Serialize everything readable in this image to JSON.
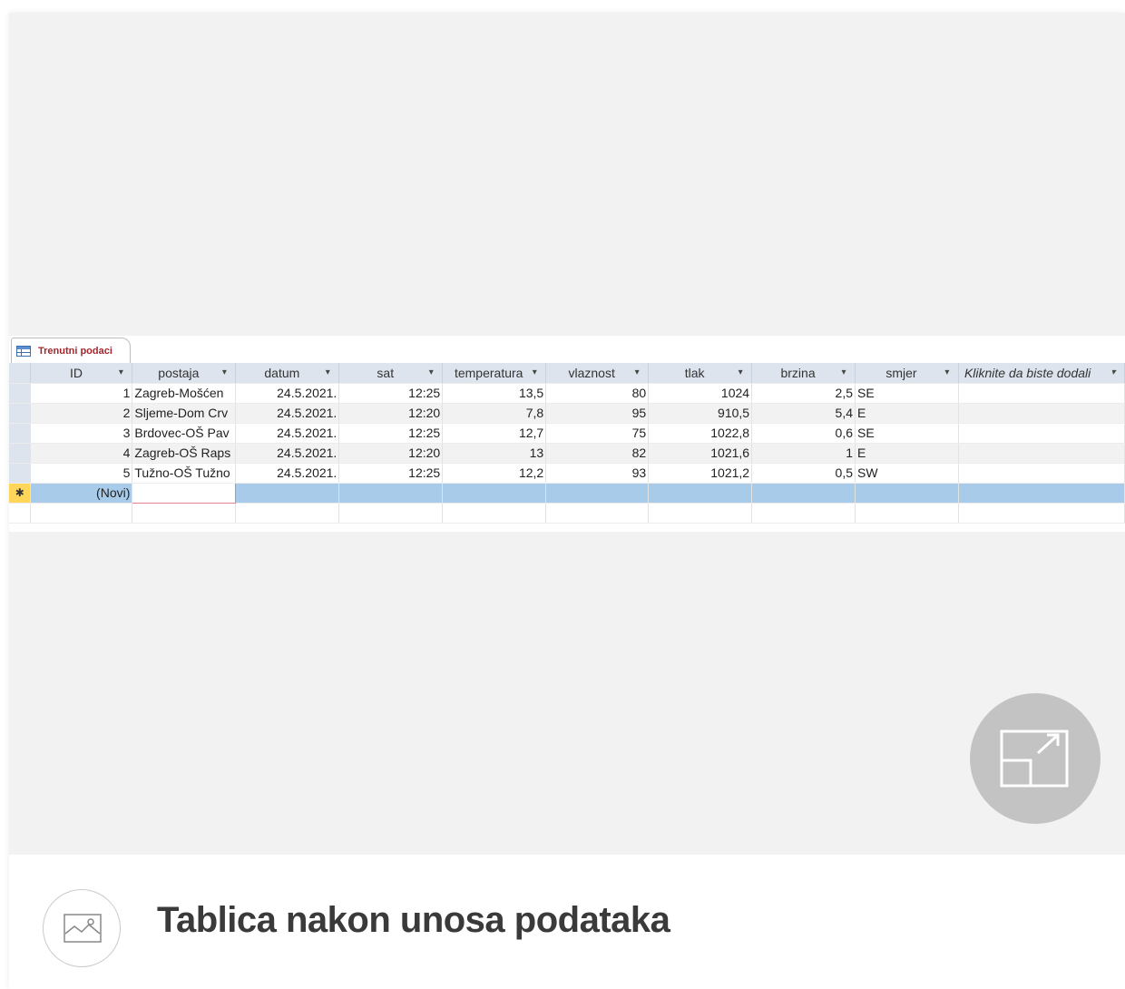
{
  "tab": {
    "label": "Trenutni podaci",
    "icon": "table-icon"
  },
  "columns": [
    {
      "label": "ID"
    },
    {
      "label": "postaja"
    },
    {
      "label": "datum"
    },
    {
      "label": "sat"
    },
    {
      "label": "temperatura"
    },
    {
      "label": "vlaznost"
    },
    {
      "label": "tlak"
    },
    {
      "label": "brzina"
    },
    {
      "label": "smjer"
    },
    {
      "label": "Kliknite da biste dodali"
    }
  ],
  "header_arrow": "▾",
  "rows": [
    {
      "id": "1",
      "postaja": "Zagreb-Mošćen",
      "datum": "24.5.2021.",
      "sat": "12:25",
      "temperatura": "13,5",
      "vlaznost": "80",
      "tlak": "1024",
      "brzina": "2,5",
      "smjer": "SE"
    },
    {
      "id": "2",
      "postaja": "Sljeme-Dom Crv",
      "datum": "24.5.2021.",
      "sat": "12:20",
      "temperatura": "7,8",
      "vlaznost": "95",
      "tlak": "910,5",
      "brzina": "5,4",
      "smjer": "E"
    },
    {
      "id": "3",
      "postaja": "Brdovec-OŠ Pav",
      "datum": "24.5.2021.",
      "sat": "12:25",
      "temperatura": "12,7",
      "vlaznost": "75",
      "tlak": "1022,8",
      "brzina": "0,6",
      "smjer": "SE"
    },
    {
      "id": "4",
      "postaja": "Zagreb-OŠ Raps",
      "datum": "24.5.2021.",
      "sat": "12:20",
      "temperatura": "13",
      "vlaznost": "82",
      "tlak": "1021,6",
      "brzina": "1",
      "smjer": "E"
    },
    {
      "id": "5",
      "postaja": "Tužno-OŠ Tužno",
      "datum": "24.5.2021.",
      "sat": "12:25",
      "temperatura": "12,2",
      "vlaznost": "93",
      "tlak": "1021,2",
      "brzina": "0,5",
      "smjer": "SW"
    }
  ],
  "new_row": {
    "marker": "✱",
    "id_label": "(Novi)"
  },
  "expand_button": {
    "icon": "expand-icon"
  },
  "caption": {
    "icon": "image-icon",
    "text": "Tablica nakon unosa podataka"
  },
  "colors": {
    "header_bg": "#dde4ee",
    "selected_header": "#ffe08a",
    "new_row": "#a9cbea",
    "tab_label": "#a4262c",
    "viewer_bg": "#f2f2f2"
  }
}
